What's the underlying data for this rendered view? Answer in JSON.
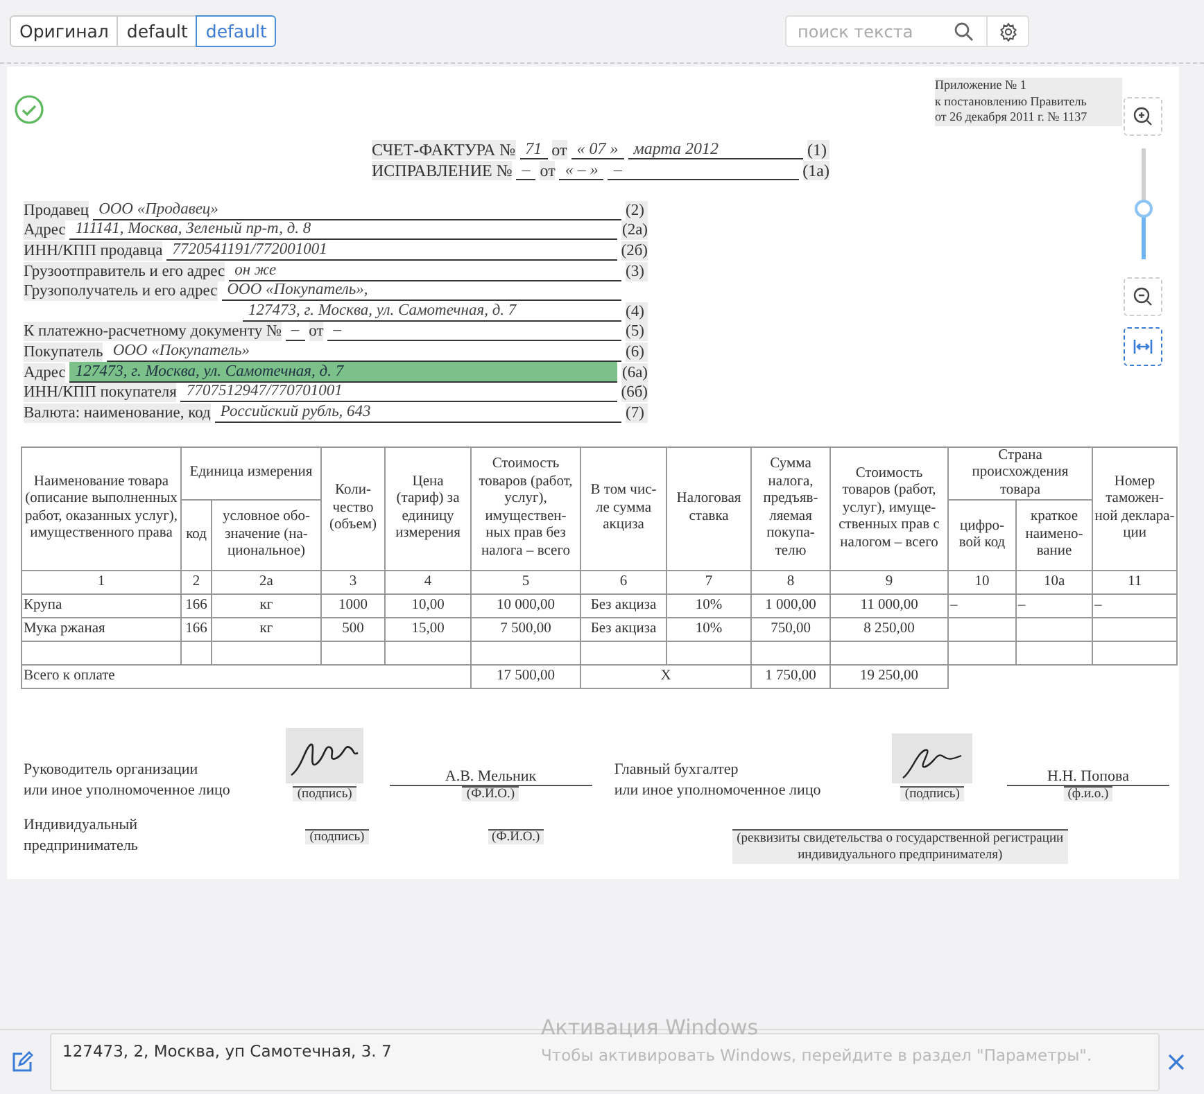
{
  "toolbar": {
    "view_tabs": [
      {
        "label": "Оригинал",
        "selected": false
      },
      {
        "label": "default",
        "selected": false
      },
      {
        "label": "default",
        "selected": true
      }
    ],
    "search": {
      "placeholder": "поиск текста"
    }
  },
  "zoom_controls": {
    "slider": {
      "level": 0.45
    },
    "fit_width": {
      "selected": true
    }
  },
  "document": {
    "verified": true,
    "appendix": [
      "Приложение № 1",
      "к постановлению Правитель",
      "от 26 декабря 2011 г. № 1137"
    ],
    "title_rows": [
      {
        "parts": [
          {
            "kind": "label",
            "text": "СЧЕТ-ФАКТУРА №"
          },
          {
            "kind": "value",
            "text": "71"
          },
          {
            "kind": "label",
            "text": "от"
          },
          {
            "kind": "value",
            "text": "« 07 »"
          },
          {
            "kind": "value",
            "text": "марта 2012"
          }
        ],
        "code": "(1)"
      },
      {
        "parts": [
          {
            "kind": "label",
            "text": "ИСПРАВЛЕНИЕ №"
          },
          {
            "kind": "value",
            "text": "–"
          },
          {
            "kind": "label",
            "text": "от"
          },
          {
            "kind": "value",
            "text": "« – »"
          },
          {
            "kind": "value",
            "text": "–"
          }
        ],
        "code": "(1а)"
      }
    ],
    "fields": [
      {
        "kind": "field",
        "highlighted": false,
        "parts": [
          {
            "kind": "label",
            "text": "Продавец"
          },
          {
            "kind": "value",
            "text": "ООО «Продавец»"
          }
        ],
        "code": "(2)"
      },
      {
        "kind": "field",
        "highlighted": false,
        "parts": [
          {
            "kind": "label",
            "text": "Адрес"
          },
          {
            "kind": "value",
            "text": "111141, Москва, Зеленый пр-т, д. 8"
          }
        ],
        "code": "(2а)"
      },
      {
        "kind": "field",
        "highlighted": false,
        "parts": [
          {
            "kind": "label",
            "text": "ИНН/КПП продавца"
          },
          {
            "kind": "value",
            "text": "7720541191/772001001"
          }
        ],
        "code": "(2б)"
      },
      {
        "kind": "field",
        "highlighted": false,
        "parts": [
          {
            "kind": "label",
            "text": "Грузоотправитель и его адрес"
          },
          {
            "kind": "value",
            "text": "он же"
          }
        ],
        "code": "(3)"
      },
      {
        "kind": "field",
        "highlighted": false,
        "parts": [
          {
            "kind": "label",
            "text": "Грузополучатель и его адрес"
          },
          {
            "kind": "value",
            "text": "ООО «Покупатель»,"
          }
        ]
      },
      {
        "kind": "continuation",
        "highlighted": false,
        "parts": [
          {
            "kind": "value",
            "text": "127473, г. Москва, ул. Самотечная, д. 7"
          }
        ],
        "code": "(4)"
      },
      {
        "kind": "field",
        "highlighted": false,
        "parts": [
          {
            "kind": "label",
            "text": "К платежно-расчетному документу №"
          },
          {
            "kind": "value",
            "text": "–"
          },
          {
            "kind": "label",
            "text": "от"
          },
          {
            "kind": "value",
            "text": "–"
          }
        ],
        "code": "(5)"
      },
      {
        "kind": "field",
        "highlighted": false,
        "parts": [
          {
            "kind": "label",
            "text": "Покупатель"
          },
          {
            "kind": "value",
            "text": "ООО «Покупатель»"
          }
        ],
        "code": "(6)"
      },
      {
        "kind": "field",
        "highlighted": true,
        "parts": [
          {
            "kind": "label",
            "text": "Адрес"
          },
          {
            "kind": "value",
            "text": "127473, г. Москва, ул. Самотечная, д. 7"
          }
        ],
        "code": "(6а)"
      },
      {
        "kind": "field",
        "highlighted": false,
        "parts": [
          {
            "kind": "label",
            "text": "ИНН/КПП покупателя"
          },
          {
            "kind": "value",
            "text": "7707512947/770701001"
          }
        ],
        "code": "(6б)"
      },
      {
        "kind": "field",
        "highlighted": false,
        "parts": [
          {
            "kind": "label",
            "text": "Валюта: наименование, код"
          },
          {
            "kind": "value",
            "text": "Российский рубль, 643"
          }
        ],
        "code": "(7)"
      }
    ],
    "table": {
      "columns": [
        {
          "text": "Наименование товара (описание выполненных работ, оказанных услуг), имущественного права"
        },
        {
          "text": "Единица измерения",
          "colspan": 2,
          "children": [
            {
              "text": "код"
            },
            {
              "text": "условное обо- значение (на- циональное)"
            }
          ]
        },
        {
          "text": "Коли- чество (объем)"
        },
        {
          "text": "Цена (тариф) за единицу измерения"
        },
        {
          "text": "Стоимость товаров (работ, услуг), имуществен- ных прав без налога – всего"
        },
        {
          "text": "В том чис- ле сумма акциза"
        },
        {
          "text": "Налоговая ставка"
        },
        {
          "text": "Сумма налога, предъяв- ляемая покупа- телю"
        },
        {
          "text": "Стоимость товаров (работ, услуг), имуще- ственных прав с налогом – всего"
        },
        {
          "text": "Страна происхождения товара",
          "colspan": 2,
          "children": [
            {
              "text": "цифро- вой код"
            },
            {
              "text": "краткое наимено- вание"
            }
          ]
        },
        {
          "text": "Номер таможен- ной деклара- ции"
        }
      ],
      "column_numbers": [
        "1",
        "2",
        "2а",
        "3",
        "4",
        "5",
        "6",
        "7",
        "8",
        "9",
        "10",
        "10а",
        "11"
      ],
      "rows": [
        [
          "Крупа",
          "166",
          "кг",
          "1000",
          "10,00",
          "10 000,00",
          "Без акциза",
          "10%",
          "1 000,00",
          "11 000,00",
          "–",
          "–",
          "–"
        ],
        [
          "Мука ржаная",
          "166",
          "кг",
          "500",
          "15,00",
          "7 500,00",
          "Без акциза",
          "10%",
          "750,00",
          "8 250,00"
        ]
      ],
      "total": {
        "label": "Всего к оплате",
        "cost_without_tax": "17 500,00",
        "excise": "X",
        "tax": "1 750,00",
        "cost_with_tax": "19 250,00"
      }
    },
    "signatures": {
      "head": {
        "title": "Руководитель организации\nили иное уполномоченное лицо",
        "signature_caption": "(подпись)",
        "name": "А.В. Мельник",
        "name_caption": "(Ф.И.О.)"
      },
      "accountant": {
        "title": "Главный бухгалтер\nили иное уполномоченное лицо",
        "signature_caption": "(подпись)",
        "name": "Н.Н. Попова",
        "name_caption": "(ф.и.о.)"
      },
      "entrepreneur": {
        "title": "Индивидуальный\nпредприниматель",
        "signature_caption": "(подпись)",
        "name_caption": "(Ф.И.О.)",
        "registration_caption": "(реквизиты свидетельства о государственной регистрации\nиндивидуального предпринимателя)"
      }
    }
  },
  "bottom_bar": {
    "value": "127473, 2, Москва, уп Самотечная, 3. 7"
  },
  "os_watermark": {
    "title": "Активация Windows",
    "message": "Чтобы активировать Windows, перейдите в раздел \"Параметры\"."
  }
}
